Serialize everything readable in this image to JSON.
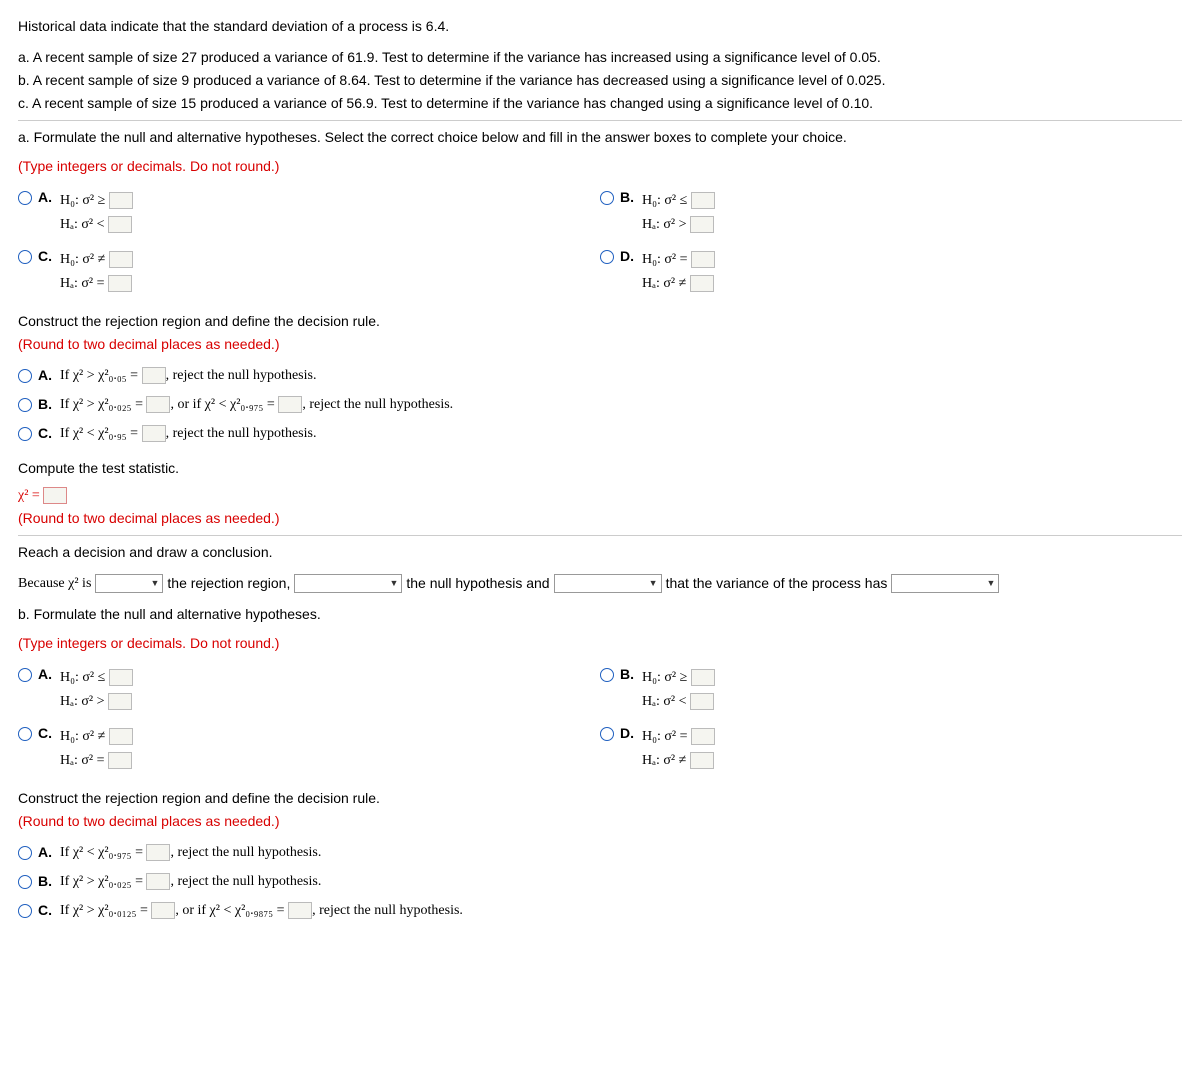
{
  "intro": {
    "line0": "Historical data indicate that the standard deviation of a process is 6.4.",
    "line_a": "a. A recent sample of size 27 produced a variance of 61.9. Test to determine if the variance has increased using a significance level of 0.05.",
    "line_b": "b. A recent sample of size 9 produced a variance of 8.64. Test to determine if the variance has decreased using a significance level of 0.025.",
    "line_c": "c. A recent sample of size 15 produced a variance of 56.9. Test to determine if the variance has changed using a significance level of 0.10."
  },
  "partA": {
    "q1": "a. Formulate the null and alternative hypotheses. Select the correct choice below and fill in the answer boxes to complete your choice.",
    "hint": "(Type integers or decimals. Do not round.)",
    "A": {
      "h0": "H₀: σ² ≥",
      "ha": "Hₐ: σ² <"
    },
    "B": {
      "h0": "H₀: σ² ≤",
      "ha": "Hₐ: σ² >"
    },
    "C": {
      "h0": "H₀: σ² ≠",
      "ha": "Hₐ: σ² ="
    },
    "D": {
      "h0": "H₀: σ² =",
      "ha": "Hₐ: σ² ≠"
    },
    "q2": "Construct the rejection region and define the decision rule.",
    "hint2": "(Round to two decimal places as needed.)",
    "rA_pre": "If χ² > χ²₀.₀₅ =",
    "rA_post": ", reject the null hypothesis.",
    "rB_pre": "If χ² > χ²₀.₀₂₅ =",
    "rB_mid": ", or if χ² < χ²₀.₉₇₅ =",
    "rB_post": ", reject the null hypothesis.",
    "rC_pre": "If χ² < χ²₀.₉₅ =",
    "rC_post": ", reject the null hypothesis.",
    "q3": "Compute the test statistic.",
    "stat": "χ² =",
    "hint3": "(Round to two decimal places as needed.)",
    "q4": "Reach a decision and draw a conclusion.",
    "conc1": "Because χ² is",
    "conc2": "the rejection region,",
    "conc3": "the null hypothesis and",
    "conc4": "that the variance of the process has"
  },
  "partB": {
    "q1": "b. Formulate the null and alternative hypotheses.",
    "hint": "(Type integers or decimals. Do not round.)",
    "A": {
      "h0": "H₀: σ² ≤",
      "ha": "Hₐ: σ² >"
    },
    "B": {
      "h0": "H₀: σ² ≥",
      "ha": "Hₐ: σ² <"
    },
    "C": {
      "h0": "H₀: σ² ≠",
      "ha": "Hₐ: σ² ="
    },
    "D": {
      "h0": "H₀: σ² =",
      "ha": "Hₐ: σ² ≠"
    },
    "q2": "Construct the rejection region and define the decision rule.",
    "hint2": "(Round to two decimal places as needed.)",
    "rA_pre": "If χ² < χ²₀.₉₇₅ =",
    "rA_post": ", reject the null hypothesis.",
    "rB_pre": "If χ² > χ²₀.₀₂₅ =",
    "rB_post": ", reject the null hypothesis.",
    "rC_pre": "If χ² > χ²₀.₀₁₂₅ =",
    "rC_mid": ", or if χ² < χ²₀.₉₈₇₅ =",
    "rC_post": ", reject the null hypothesis."
  },
  "labels": {
    "A": "A.",
    "B": "B.",
    "C": "C.",
    "D": "D."
  }
}
